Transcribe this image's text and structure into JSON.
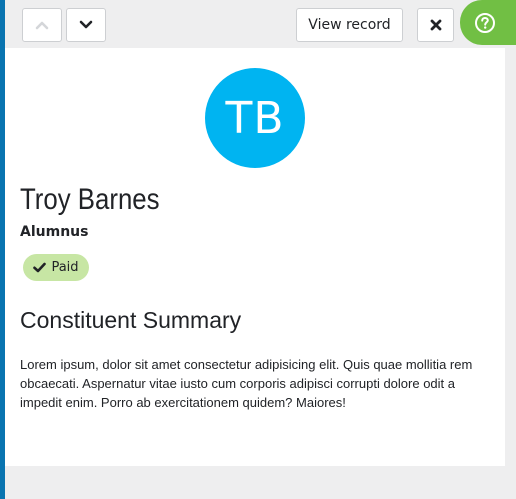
{
  "toolbar": {
    "view_record_label": "View record"
  },
  "profile": {
    "initials": "TB",
    "name": "Troy Barnes",
    "role": "Alumnus",
    "status_badge": "Paid"
  },
  "summary": {
    "heading": "Constituent Summary",
    "body": "Lorem ipsum, dolor sit amet consectetur adipisicing elit. Quis quae mollitia rem obcaecati. Aspernatur vitae iusto cum corporis adipisci corrupti dolore odit a impedit enim. Porro ab exercitationem quidem? Maiores!"
  },
  "colors": {
    "accent_bar": "#0974b0",
    "avatar_bg": "#00b4f1",
    "help_tab": "#71bf44",
    "badge_bg": "#c7e6a4"
  },
  "icons": {
    "previous": "chevron-up-icon",
    "next": "chevron-down-icon",
    "close": "close-icon",
    "help": "help-icon",
    "badge": "check-icon"
  }
}
